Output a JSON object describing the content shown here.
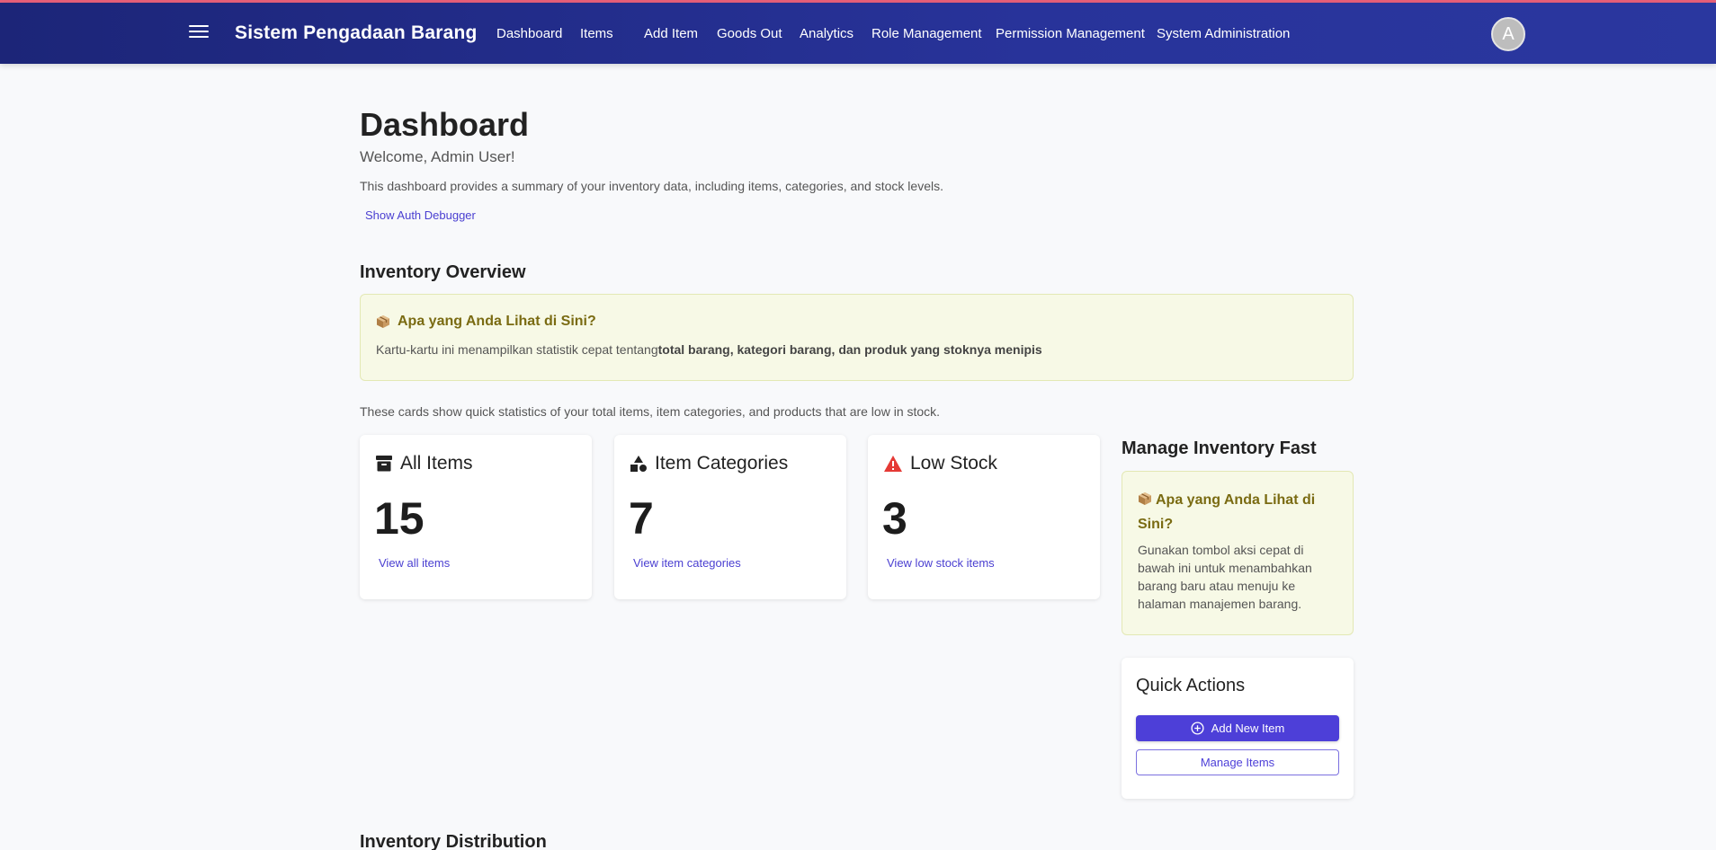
{
  "colors": {
    "accent": "#e8607a",
    "header": "#232d8a",
    "primary": "#4d3fd8",
    "warning": "#e53935"
  },
  "header": {
    "title": "Sistem Pengadaan Barang",
    "nav": [
      "Dashboard",
      "Items",
      "Add Item",
      "Goods Out",
      "Analytics",
      "Role Management",
      "Permission Management",
      "System Administration"
    ],
    "avatar_initial": "A"
  },
  "page": {
    "title": "Dashboard",
    "welcome": "Welcome, Admin User!",
    "description": "This dashboard provides a summary of your inventory data, including items, categories, and stock levels.",
    "debug_link": "Show Auth Debugger"
  },
  "overview": {
    "title": "Inventory Overview",
    "info": {
      "icon": "package-icon",
      "heading": "Apa yang Anda Lihat di Sini?",
      "body_prefix": "Kartu-kartu ini menampilkan statistik cepat tentang",
      "body_bold": "total barang, kategori barang, dan produk yang stoknya menipis"
    },
    "caption": "These cards show quick statistics of your total items, item categories, and products that are low in stock."
  },
  "stats": [
    {
      "icon": "archive-box-icon",
      "label": "All Items",
      "value": "15",
      "link": "View all items"
    },
    {
      "icon": "shapes-icon",
      "label": "Item Categories",
      "value": "7",
      "link": "View item categories"
    },
    {
      "icon": "warning-icon",
      "label": "Low Stock",
      "value": "3",
      "link": "View low stock items"
    }
  ],
  "manage": {
    "title": "Manage Inventory Fast",
    "info": {
      "icon": "package-icon",
      "heading": "Apa yang Anda Lihat di Sini?",
      "body": "Gunakan tombol aksi cepat di bawah ini untuk menambahkan barang baru atau menuju ke halaman manajemen barang."
    },
    "quick_actions": {
      "title": "Quick Actions",
      "add_label": "Add New Item",
      "manage_label": "Manage Items"
    }
  },
  "distribution": {
    "title": "Inventory Distribution"
  }
}
